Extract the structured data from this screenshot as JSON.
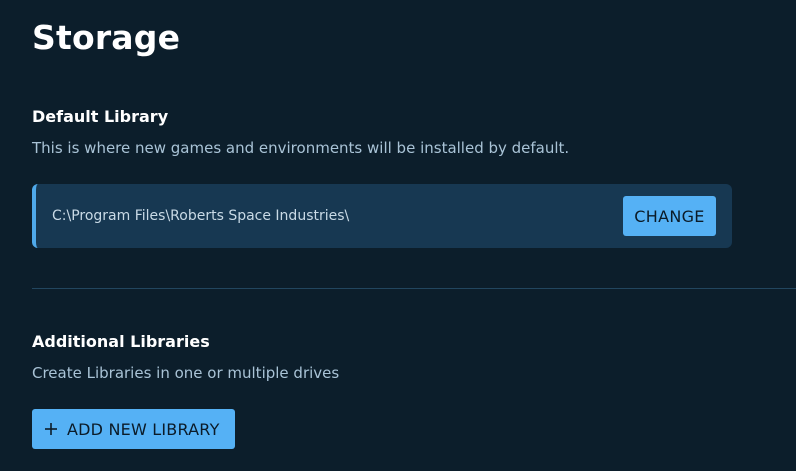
{
  "page": {
    "title": "Storage"
  },
  "default_library": {
    "title": "Default Library",
    "description": "This is where new games and environments will be installed by default.",
    "path": "C:\\Program Files\\Roberts Space Industries\\",
    "change_label": "CHANGE"
  },
  "additional_libraries": {
    "title": "Additional Libraries",
    "description": "Create Libraries in one or multiple drives",
    "add_label": "ADD NEW LIBRARY",
    "add_icon": "plus-icon"
  },
  "colors": {
    "background": "#0c1e2b",
    "panel": "#173852",
    "accent": "#55b1f5",
    "accent_border": "#4fa9ea",
    "muted_text": "#a9c3d6"
  }
}
